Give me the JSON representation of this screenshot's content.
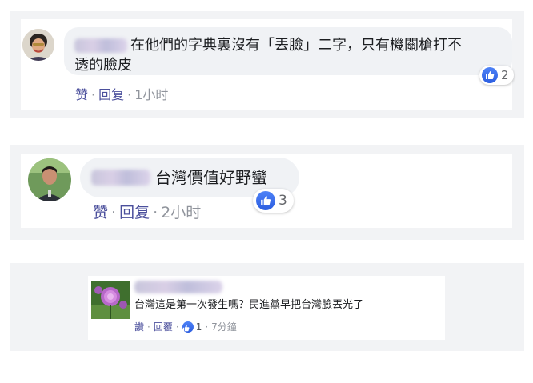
{
  "comments": [
    {
      "text_line1": "在他們的字典裏沒有「丟臉」二字，只有機關槍打不",
      "text_line2": "透的臉皮",
      "like_label": "赞",
      "reply_label": "回复",
      "time": "1小时",
      "reaction_count": "2"
    },
    {
      "text": "台灣價值好野蠻",
      "like_label": "赞",
      "reply_label": "回复",
      "time": "2小时",
      "reaction_count": "3"
    },
    {
      "text": "台灣這是第一次發生嗎？民進黨早把台灣臉丟光了",
      "like_label": "讚",
      "reply_label": "回覆",
      "reaction_count": "1",
      "time": "7分鐘"
    }
  ],
  "colors": {
    "panel": "#f2f3f5",
    "bubble": "#f0f2f5",
    "action_link": "#4b4f9c",
    "like_blue": "#2b5de0"
  },
  "icons": [
    "avatar-woman",
    "avatar-man",
    "avatar-thistle-flower",
    "thumbs-up-icon"
  ]
}
